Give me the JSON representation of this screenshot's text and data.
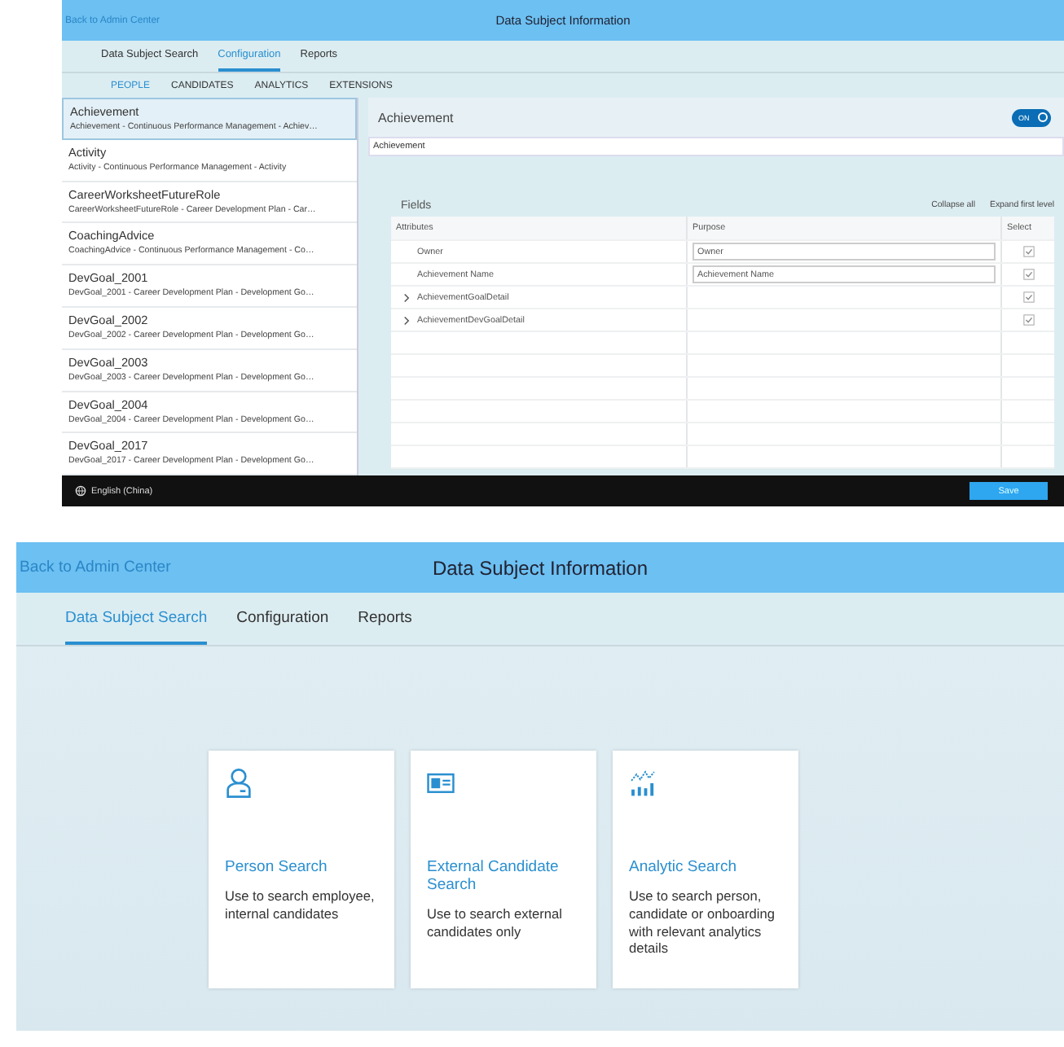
{
  "configuration_view": {
    "header": {
      "back_link": "Back to Admin Center",
      "title": "Data Subject Information"
    },
    "tabs": [
      {
        "label": "Data Subject Search",
        "selected": false
      },
      {
        "label": "Configuration",
        "selected": true
      },
      {
        "label": "Reports",
        "selected": false
      }
    ],
    "subtabs": [
      {
        "label": "PEOPLE",
        "selected": true
      },
      {
        "label": "CANDIDATES",
        "selected": false
      },
      {
        "label": "ANALYTICS",
        "selected": false
      },
      {
        "label": "EXTENSIONS",
        "selected": false
      }
    ],
    "list_items": [
      {
        "title": "Achievement",
        "subtitle": "Achievement - Continuous Performance Management - Achiev…",
        "selected": true
      },
      {
        "title": "Activity",
        "subtitle": "Activity - Continuous Performance Management - Activity",
        "selected": false
      },
      {
        "title": "CareerWorksheetFutureRole",
        "subtitle": "CareerWorksheetFutureRole - Career Development Plan - Car…",
        "selected": false
      },
      {
        "title": "CoachingAdvice",
        "subtitle": "CoachingAdvice - Continuous Performance Management - Co…",
        "selected": false
      },
      {
        "title": "DevGoal_2001",
        "subtitle": "DevGoal_2001 - Career Development Plan - Development Go…",
        "selected": false
      },
      {
        "title": "DevGoal_2002",
        "subtitle": "DevGoal_2002 - Career Development Plan - Development Go…",
        "selected": false
      },
      {
        "title": "DevGoal_2003",
        "subtitle": "DevGoal_2003 - Career Development Plan - Development Go…",
        "selected": false
      },
      {
        "title": "DevGoal_2004",
        "subtitle": "DevGoal_2004 - Career Development Plan - Development Go…",
        "selected": false
      },
      {
        "title": "DevGoal_2017",
        "subtitle": "DevGoal_2017 - Career Development Plan - Development Go…",
        "selected": false
      }
    ],
    "detail": {
      "title": "Achievement",
      "toggle": {
        "label": "ON",
        "on": true
      },
      "name_value": "Achievement",
      "fields_title": "Fields",
      "actions": [
        "Collapse all",
        "Expand first level"
      ],
      "columns": [
        "Attributes",
        "Purpose",
        "Select"
      ],
      "rows": [
        {
          "kind": "field",
          "attribute": "Owner",
          "purpose": "Owner",
          "checked": true
        },
        {
          "kind": "field",
          "attribute": "Achievement Name",
          "purpose": "Achievement Name",
          "checked": true
        },
        {
          "kind": "group",
          "attribute": "AchievementGoalDetail",
          "checked": true
        },
        {
          "kind": "group",
          "attribute": "AchievementDevGoalDetail",
          "checked": true
        }
      ]
    },
    "footer": {
      "language": "English (China)",
      "save": "Save"
    }
  },
  "search_view": {
    "header": {
      "back_link": "Back to Admin Center",
      "title": "Data Subject Information"
    },
    "tabs": [
      {
        "label": "Data Subject Search",
        "selected": true
      },
      {
        "label": "Configuration",
        "selected": false
      },
      {
        "label": "Reports",
        "selected": false
      }
    ],
    "cards": [
      {
        "kind": "person",
        "title": "Person Search",
        "description": "Use to search employee, internal candidates"
      },
      {
        "kind": "candidate",
        "title": "External Candidate Search",
        "description": "Use to search external candidates only"
      },
      {
        "kind": "analytics",
        "title": "Analytic Search",
        "description": "Use to search person, candidate or onboarding with relevant analytics details"
      }
    ]
  }
}
